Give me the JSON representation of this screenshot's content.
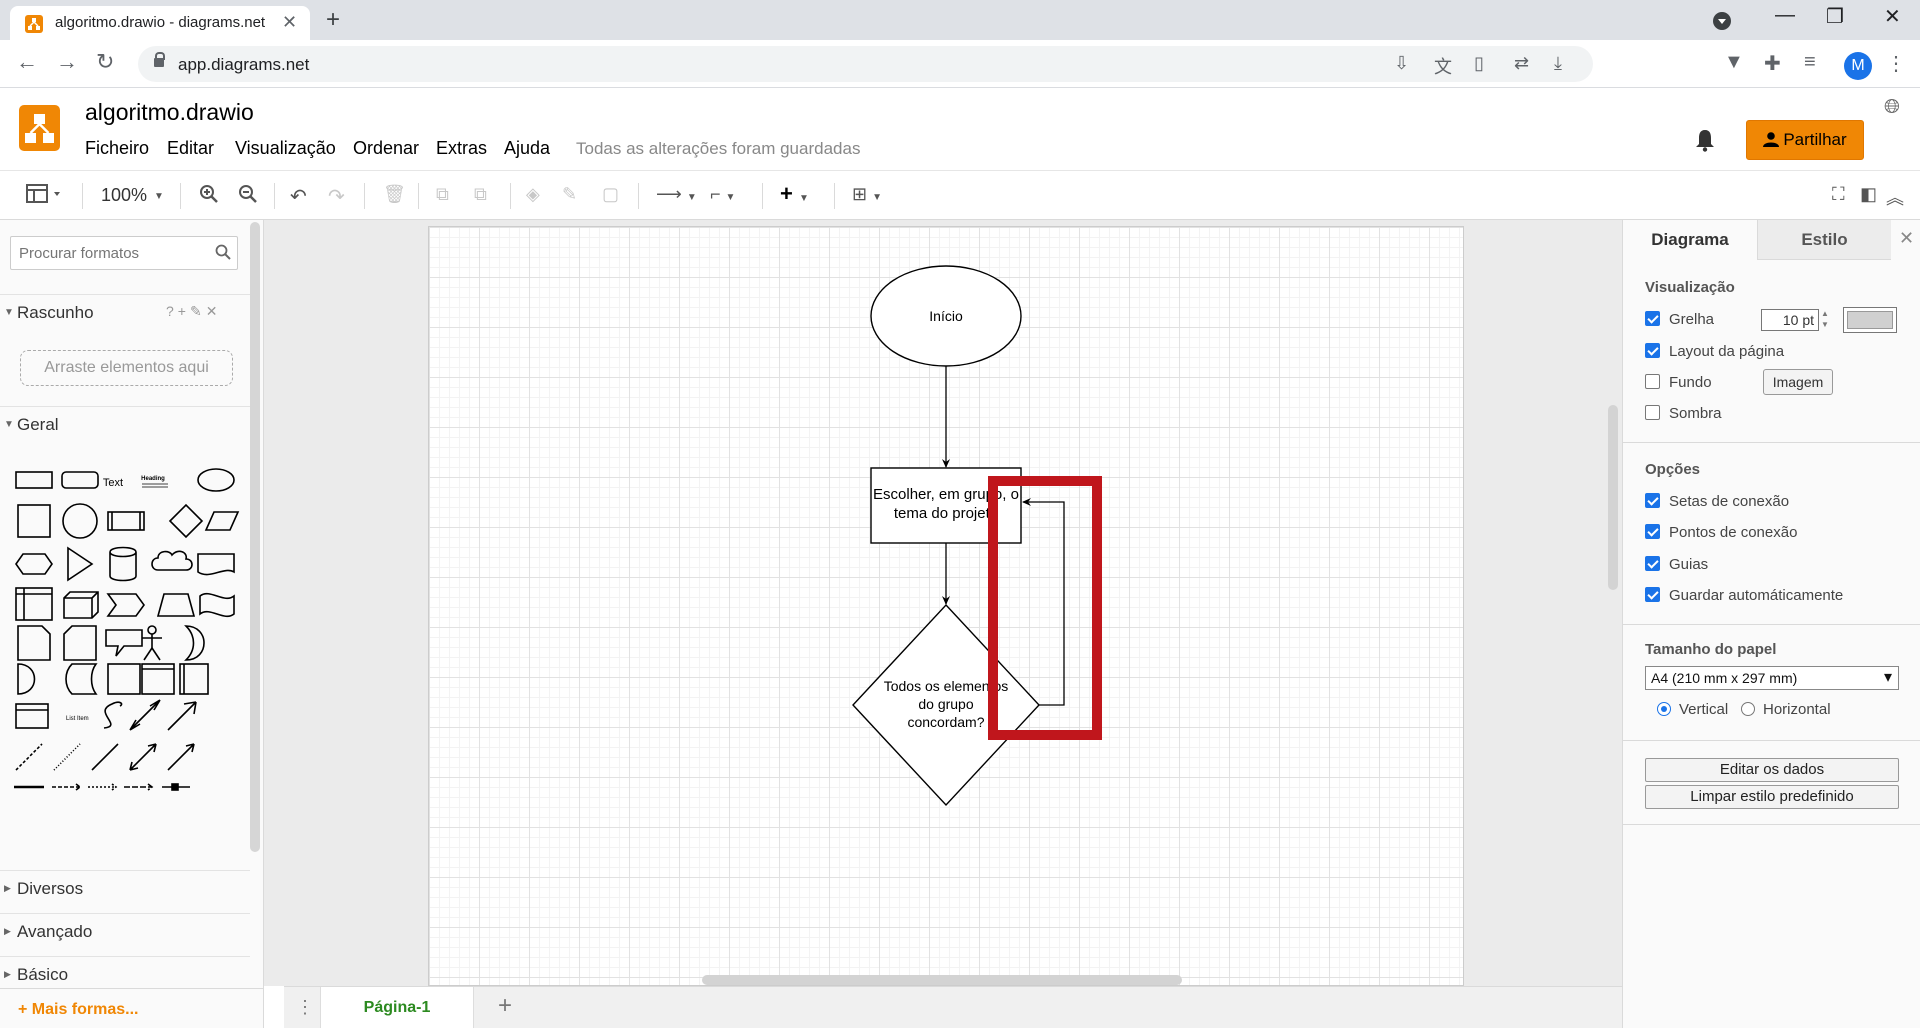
{
  "browser": {
    "tab_title": "algoritmo.drawio - diagrams.net",
    "url": "app.diagrams.net",
    "profile_initial": "M"
  },
  "app": {
    "doc_title": "algoritmo.drawio",
    "menu": [
      "Ficheiro",
      "Editar",
      "Visualização",
      "Ordenar",
      "Extras",
      "Ajuda"
    ],
    "save_status": "Todas as alterações foram guardadas",
    "share_label": "Partilhar"
  },
  "toolbar": {
    "zoom": "100%"
  },
  "left_panel": {
    "search_placeholder": "Procurar formatos",
    "scratch_label": "Rascunho",
    "scratch_tools": "?+✎✕",
    "drop_zone": "Arraste elementos aqui",
    "general_label": "Geral",
    "shape_text_label": "Text",
    "shape_heading_label": "Heading",
    "list_item_label": "List Item",
    "collapsed_sections": [
      "Diversos",
      "Avançado",
      "Básico"
    ],
    "more_shapes": "+ Mais formas..."
  },
  "diagram": {
    "start_label": "Início",
    "process_label_line1": "Escolher, em grupo, o",
    "process_label_line2": "tema do projeto",
    "decision_label_line1": "Todos os elementos",
    "decision_label_line2": "do grupo",
    "decision_label_line3": "concordam?",
    "highlight_color": "#c0161c"
  },
  "page_tabs": {
    "active": "Página-1"
  },
  "right_panel": {
    "tab_diagram": "Diagrama",
    "tab_style": "Estilo",
    "view_header": "Visualização",
    "grid_label": "Grelha",
    "grid_size": "10 pt",
    "page_layout_label": "Layout da página",
    "background_label": "Fundo",
    "image_button": "Imagem",
    "shadow_label": "Sombra",
    "options_header": "Opções",
    "connection_arrows": "Setas de conexão",
    "connection_points": "Pontos de conexão",
    "guides": "Guias",
    "autosave": "Guardar automáticamente",
    "paper_header": "Tamanho do papel",
    "paper_size": "A4 (210 mm x 297 mm)",
    "portrait": "Vertical",
    "landscape": "Horizontal",
    "edit_data": "Editar os dados",
    "clear_style": "Limpar estilo predefinido"
  },
  "colors": {
    "accent": "#f08705",
    "page_tab_text": "#2c8a20",
    "checkbox": "#1a73e8"
  }
}
